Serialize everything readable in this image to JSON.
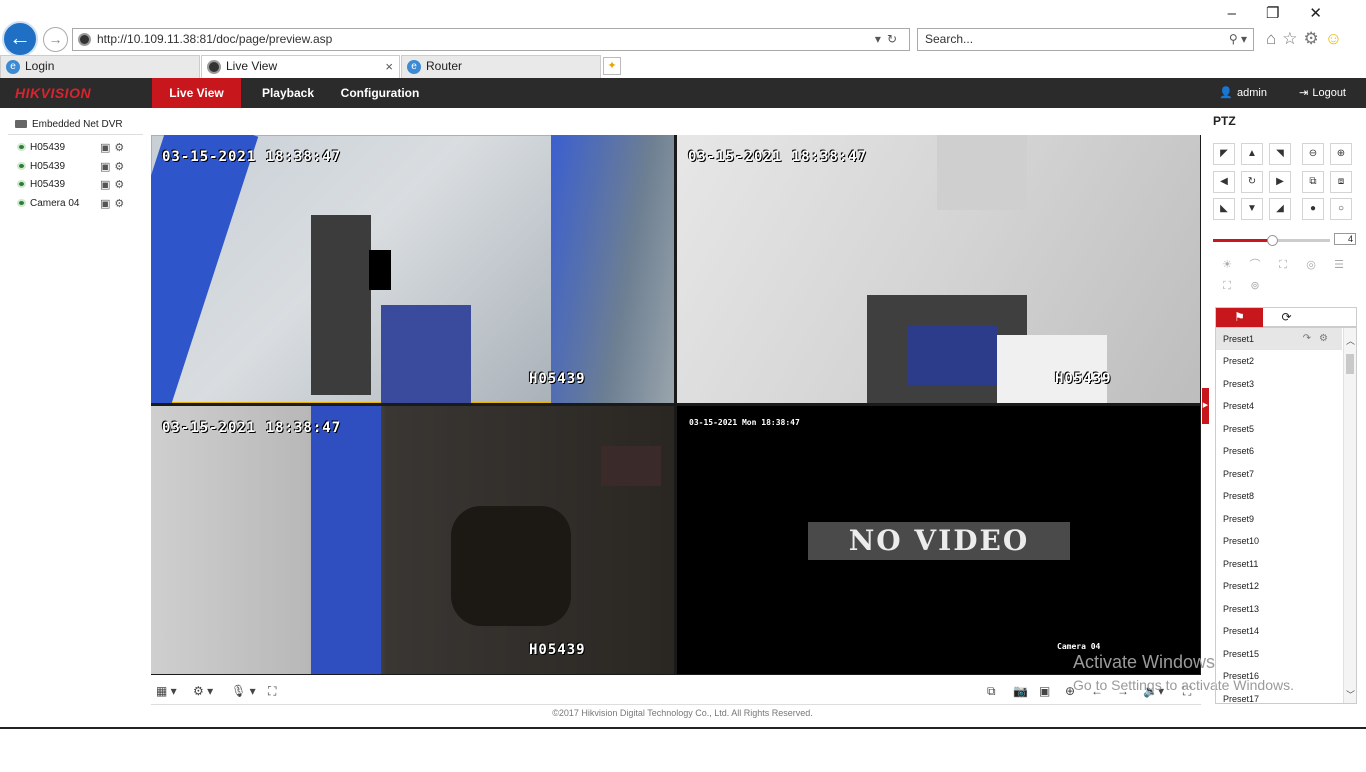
{
  "browser": {
    "url": "http://10.109.11.38:81/doc/page/preview.asp",
    "search_placeholder": "Search...",
    "tabs": [
      {
        "label": "Login"
      },
      {
        "label": "Live View",
        "active": true
      },
      {
        "label": "Router"
      }
    ]
  },
  "header": {
    "logo": "HIKVISION",
    "nav": [
      "Live View",
      "Playback",
      "Configuration"
    ],
    "active_nav": "Live View",
    "user": "admin",
    "logout": "Logout"
  },
  "tree": {
    "root": "Embedded Net DVR",
    "cameras": [
      {
        "name": "H05439"
      },
      {
        "name": "H05439"
      },
      {
        "name": "H05439"
      },
      {
        "name": "Camera 04"
      }
    ]
  },
  "video": {
    "tiles": [
      {
        "timestamp": "03-15-2021 18:38:47",
        "name": "H05439",
        "selected": true
      },
      {
        "timestamp": "03-15-2021 18:38:47",
        "name": "H05439"
      },
      {
        "timestamp": "03-15-2021 18:38:47",
        "name": "H05439"
      },
      {
        "timestamp": "03-15-2021 Mon 18:38:47",
        "name": "Camera 04",
        "status": "NO VIDEO"
      }
    ]
  },
  "ptz": {
    "title": "PTZ",
    "speed": "4",
    "speed_fraction": 0.5,
    "presets": [
      "Preset1",
      "Preset2",
      "Preset3",
      "Preset4",
      "Preset5",
      "Preset6",
      "Preset7",
      "Preset8",
      "Preset9",
      "Preset10",
      "Preset11",
      "Preset12",
      "Preset13",
      "Preset14",
      "Preset15",
      "Preset16",
      "Preset17"
    ]
  },
  "watermark": {
    "line1": "Activate Windows",
    "line2": "Go to Settings to activate Windows."
  },
  "footer": "©2017 Hikvision Digital Technology Co., Ltd. All Rights Reserved.",
  "colors": {
    "accent": "#c8161d",
    "header_bg": "#2b2b2b",
    "selected_tile": "#e8b400"
  }
}
